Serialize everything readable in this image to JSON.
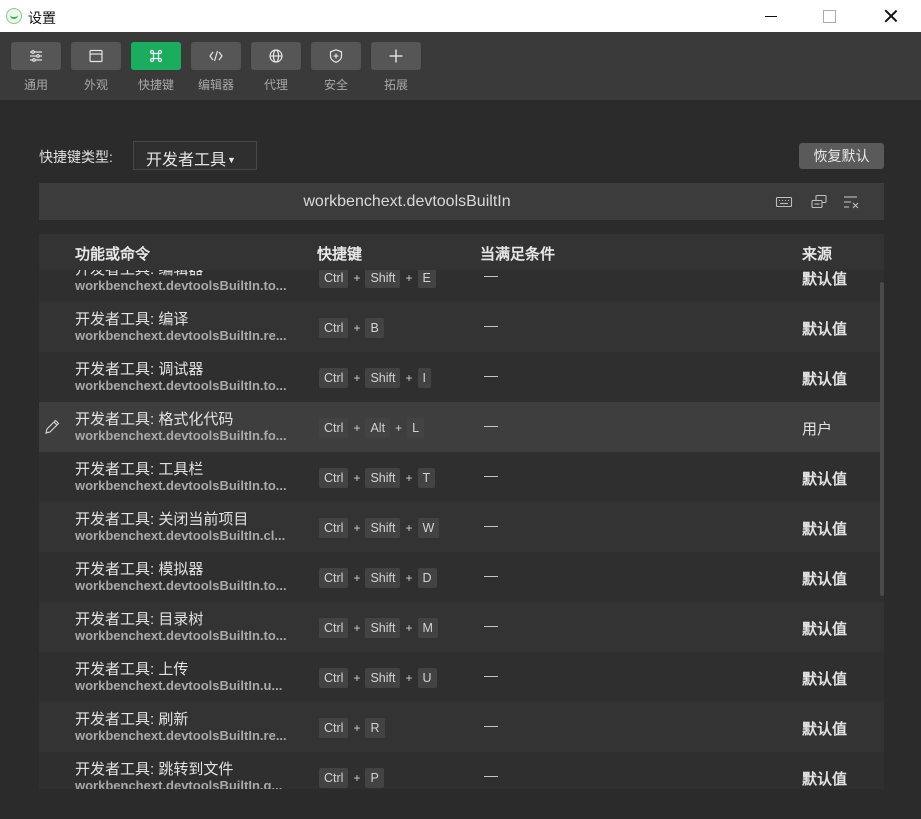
{
  "window": {
    "title": "设置"
  },
  "toolbar": {
    "items": [
      {
        "label": "通用",
        "icon": "sliders-icon"
      },
      {
        "label": "外观",
        "icon": "window-icon"
      },
      {
        "label": "快捷键",
        "icon": "command-key-icon"
      },
      {
        "label": "编辑器",
        "icon": "code-icon"
      },
      {
        "label": "代理",
        "icon": "globe-icon"
      },
      {
        "label": "安全",
        "icon": "shield-icon"
      },
      {
        "label": "拓展",
        "icon": "plus-icon"
      }
    ],
    "active": "快捷键",
    "accent": "#1aad5e"
  },
  "shortcut_type": {
    "label": "快捷键类型:",
    "value": "开发者工具"
  },
  "reset_button": "恢复默认",
  "category": {
    "name": "workbenchext.devtoolsBuiltIn"
  },
  "table": {
    "headers": {
      "command": "功能或命令",
      "keybinding": "快捷键",
      "when": "当满足条件",
      "source": "来源"
    },
    "rows": [
      {
        "title": "开发者工具: 编辑器",
        "id": "workbenchext.devtoolsBuiltIn.to...",
        "keys": [
          "Ctrl",
          "Shift",
          "E"
        ],
        "when": "—",
        "source": "默认值"
      },
      {
        "title": "开发者工具: 编译",
        "id": "workbenchext.devtoolsBuiltIn.re...",
        "keys": [
          "Ctrl",
          "B"
        ],
        "when": "—",
        "source": "默认值"
      },
      {
        "title": "开发者工具: 调试器",
        "id": "workbenchext.devtoolsBuiltIn.to...",
        "keys": [
          "Ctrl",
          "Shift",
          "I"
        ],
        "when": "—",
        "source": "默认值"
      },
      {
        "title": "开发者工具: 格式化代码",
        "id": "workbenchext.devtoolsBuiltIn.fo...",
        "keys": [
          "Ctrl",
          "Alt",
          "L"
        ],
        "when": "—",
        "source": "用户"
      },
      {
        "title": "开发者工具: 工具栏",
        "id": "workbenchext.devtoolsBuiltIn.to...",
        "keys": [
          "Ctrl",
          "Shift",
          "T"
        ],
        "when": "—",
        "source": "默认值"
      },
      {
        "title": "开发者工具: 关闭当前项目",
        "id": "workbenchext.devtoolsBuiltIn.cl...",
        "keys": [
          "Ctrl",
          "Shift",
          "W"
        ],
        "when": "—",
        "source": "默认值"
      },
      {
        "title": "开发者工具: 模拟器",
        "id": "workbenchext.devtoolsBuiltIn.to...",
        "keys": [
          "Ctrl",
          "Shift",
          "D"
        ],
        "when": "—",
        "source": "默认值"
      },
      {
        "title": "开发者工具: 目录树",
        "id": "workbenchext.devtoolsBuiltIn.to...",
        "keys": [
          "Ctrl",
          "Shift",
          "M"
        ],
        "when": "—",
        "source": "默认值"
      },
      {
        "title": "开发者工具: 上传",
        "id": "workbenchext.devtoolsBuiltIn.u...",
        "keys": [
          "Ctrl",
          "Shift",
          "U"
        ],
        "when": "—",
        "source": "默认值"
      },
      {
        "title": "开发者工具: 刷新",
        "id": "workbenchext.devtoolsBuiltIn.re...",
        "keys": [
          "Ctrl",
          "R"
        ],
        "when": "—",
        "source": "默认值"
      },
      {
        "title": "开发者工具: 跳转到文件",
        "id": "workbenchext.devtoolsBuiltIn.g...",
        "keys": [
          "Ctrl",
          "P"
        ],
        "when": "—",
        "source": "默认值"
      }
    ]
  }
}
